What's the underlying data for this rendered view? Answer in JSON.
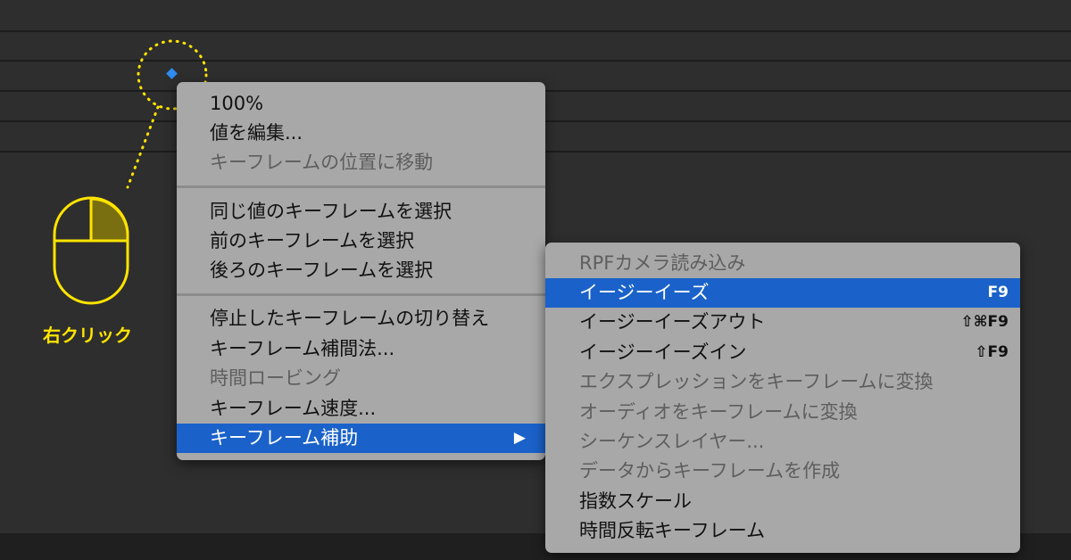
{
  "annotation": {
    "label": "右クリック",
    "color": "#ffe400"
  },
  "main_menu": {
    "items": [
      {
        "label": "100%",
        "disabled": false
      },
      {
        "label": "値を編集...",
        "disabled": false
      },
      {
        "label": "キーフレームの位置に移動",
        "disabled": true
      },
      {
        "label": "同じ値のキーフレームを選択",
        "disabled": false
      },
      {
        "label": "前のキーフレームを選択",
        "disabled": false
      },
      {
        "label": "後ろのキーフレームを選択",
        "disabled": false
      },
      {
        "label": "停止したキーフレームの切り替え",
        "disabled": false
      },
      {
        "label": "キーフレーム補間法...",
        "disabled": false
      },
      {
        "label": "時間ロービング",
        "disabled": true
      },
      {
        "label": "キーフレーム速度...",
        "disabled": false
      },
      {
        "label": "キーフレーム補助",
        "disabled": false,
        "highlighted": true,
        "submenu_arrow": "▶"
      }
    ]
  },
  "sub_menu": {
    "items": [
      {
        "label": "RPFカメラ読み込み",
        "disabled": true
      },
      {
        "label": "イージーイーズ",
        "shortcut": "F9",
        "highlighted": true
      },
      {
        "label": "イージーイーズアウト",
        "shortcut": "⇧⌘F9"
      },
      {
        "label": "イージーイーズイン",
        "shortcut": "⇧F9"
      },
      {
        "label": "エクスプレッションをキーフレームに変換",
        "disabled": true
      },
      {
        "label": "オーディオをキーフレームに変換",
        "disabled": true
      },
      {
        "label": "シーケンスレイヤー...",
        "disabled": true
      },
      {
        "label": "データからキーフレームを作成",
        "disabled": true
      },
      {
        "label": "指数スケール",
        "disabled": false
      },
      {
        "label": "時間反転キーフレーム",
        "disabled": false
      }
    ]
  },
  "colors": {
    "menu_bg": "#a8a8a8",
    "highlight": "#1a62c9",
    "keyframe": "#2f8cf0"
  }
}
